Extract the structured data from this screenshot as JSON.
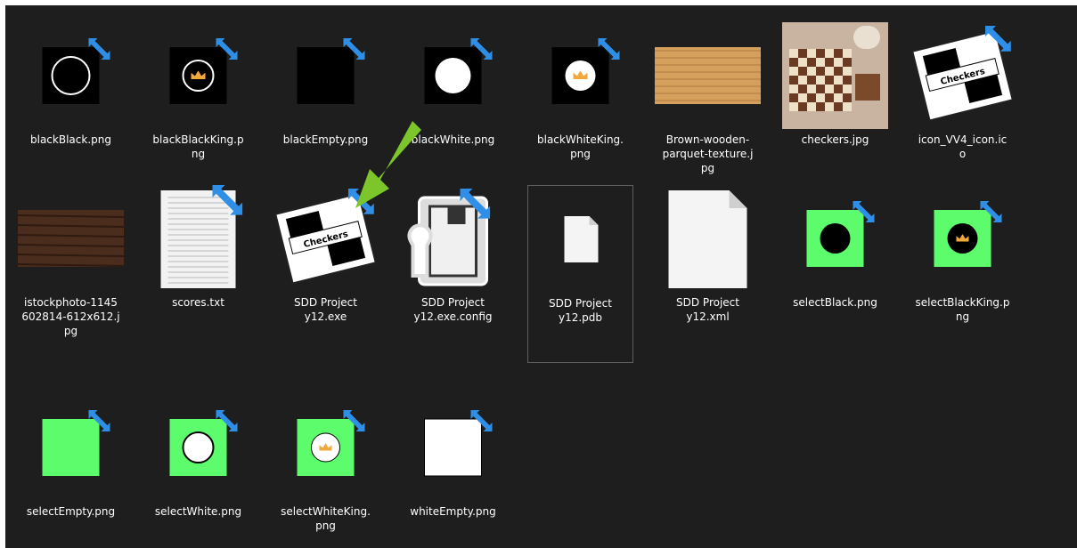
{
  "files": [
    {
      "name": "blackBlack.png",
      "label_lines": [
        "blackBlack.png"
      ],
      "thumb": "black-ring"
    },
    {
      "name": "blackBlackKing.png",
      "label_lines": [
        "blackBlackKing.p",
        "ng"
      ],
      "thumb": "black-king"
    },
    {
      "name": "blackEmpty.png",
      "label_lines": [
        "blackEmpty.png"
      ],
      "thumb": "black-empty"
    },
    {
      "name": "blackWhite.png",
      "label_lines": [
        "blackWhite.png"
      ],
      "thumb": "black-white"
    },
    {
      "name": "blackWhiteKing.png",
      "label_lines": [
        "blackWhiteKing.",
        "png"
      ],
      "thumb": "black-white-king"
    },
    {
      "name": "Brown-wooden-parquet-texture.jpg",
      "label_lines": [
        "Brown-wooden-",
        "parquet-texture.j",
        "pg"
      ],
      "thumb": "parquet"
    },
    {
      "name": "checkers.jpg",
      "label_lines": [
        "checkers.jpg"
      ],
      "thumb": "checkers-photo"
    },
    {
      "name": "icon_VV4_icon.ico",
      "label_lines": [
        "icon_VV4_icon.ic",
        "o"
      ],
      "thumb": "checkers-icon"
    },
    {
      "name": "istockphoto-1145602814-612x612.jpg",
      "label_lines": [
        "istockphoto-1145",
        "602814-612x612.j",
        "pg"
      ],
      "thumb": "dark-wood"
    },
    {
      "name": "scores.txt",
      "label_lines": [
        "scores.txt"
      ],
      "thumb": "text-doc"
    },
    {
      "name": "SDD Project y12.exe",
      "label_lines": [
        "SDD Project",
        "y12.exe"
      ],
      "thumb": "checkers-icon"
    },
    {
      "name": "SDD Project y12.exe.config",
      "label_lines": [
        "SDD Project",
        "y12.exe.config"
      ],
      "thumb": "config"
    },
    {
      "name": "SDD Project y12.pdb",
      "label_lines": [
        "SDD Project",
        "y12.pdb"
      ],
      "thumb": "blank-doc-small"
    },
    {
      "name": "SDD Project y12.xml",
      "label_lines": [
        "SDD Project",
        "y12.xml"
      ],
      "thumb": "blank-doc-large"
    },
    {
      "name": "selectBlack.png",
      "label_lines": [
        "selectBlack.png"
      ],
      "thumb": "green-black"
    },
    {
      "name": "selectBlackKing.png",
      "label_lines": [
        "selectBlackKing.p",
        "ng"
      ],
      "thumb": "green-black-king"
    },
    {
      "name": "selectEmpty.png",
      "label_lines": [
        "selectEmpty.png"
      ],
      "thumb": "green-empty"
    },
    {
      "name": "selectWhite.png",
      "label_lines": [
        "selectWhite.png"
      ],
      "thumb": "green-white"
    },
    {
      "name": "selectWhiteKing.png",
      "label_lines": [
        "selectWhiteKing.",
        "png"
      ],
      "thumb": "green-white-king"
    },
    {
      "name": "whiteEmpty.png",
      "label_lines": [
        "whiteEmpty.png"
      ],
      "thumb": "white-empty"
    }
  ],
  "icon_text": "Checkers",
  "selected_file": "SDD Project y12.pdb",
  "colors": {
    "background": "#1e1e1e",
    "label_text": "#ffffff",
    "select_green": "#5cfc6c",
    "shortcut_blue": "#2f8ee6",
    "arrow_green": "#7cc52b",
    "crown": "#f2a93b"
  }
}
